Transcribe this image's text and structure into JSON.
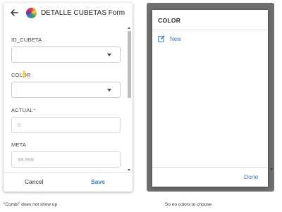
{
  "form": {
    "title": "DETALLE CUBETAS Form",
    "fields": {
      "id_cubeta": {
        "label": "ID_CUBETA",
        "value": ""
      },
      "color": {
        "label": "COLOR",
        "value": ""
      },
      "actual": {
        "label": "ACTUAL",
        "required_mark": "*",
        "placeholder": "0"
      },
      "meta": {
        "label": "META",
        "placeholder": "99.999"
      }
    },
    "buttons": {
      "cancel": "Cancel",
      "save": "Save"
    }
  },
  "color_dialog": {
    "title": "COLOR",
    "new_label": "New",
    "done_label": "Done"
  },
  "captions": {
    "left": "\"Combi\" does not show up",
    "right": "So no colors to choose"
  },
  "colors": {
    "accent": "#2f7fd6",
    "backdrop": "#6f6f6f",
    "highlight": "#f5d742"
  }
}
